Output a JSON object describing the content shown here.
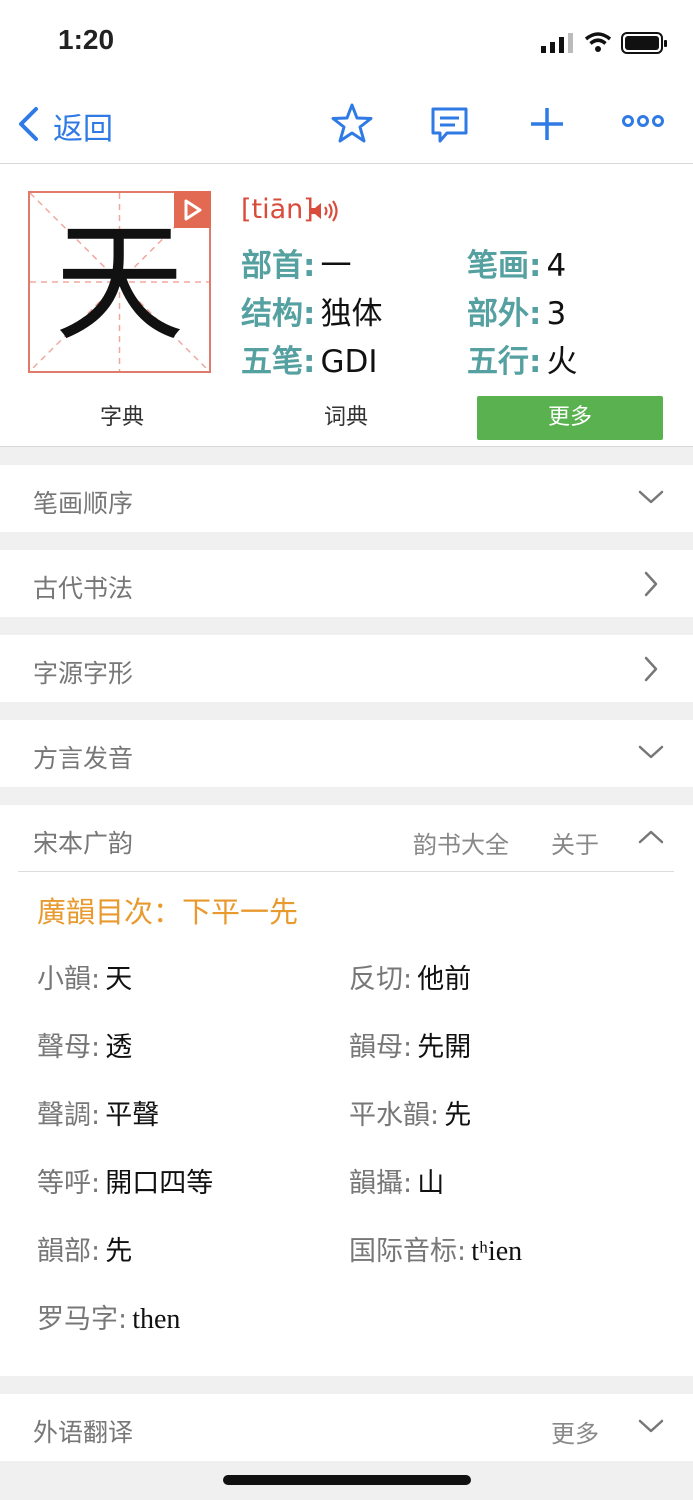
{
  "status": {
    "time": "1:20"
  },
  "nav": {
    "back_label": "返回"
  },
  "entry": {
    "character": "天",
    "pinyin": "[tiān]",
    "props": [
      {
        "label": "部首:",
        "value": "一"
      },
      {
        "label": "笔画:",
        "value": "4"
      },
      {
        "label": "结构:",
        "value": "独体"
      },
      {
        "label": "部外:",
        "value": "3"
      },
      {
        "label": "五笔:",
        "value": "GDI"
      },
      {
        "label": "五行:",
        "value": "火"
      }
    ]
  },
  "tabs": [
    {
      "label": "字典",
      "active": false
    },
    {
      "label": "词典",
      "active": false
    },
    {
      "label": "更多",
      "active": true
    }
  ],
  "sections": {
    "stroke_order": "笔画顺序",
    "calligraphy": "古代书法",
    "etymology": "字源字形",
    "dialect": "方言发音",
    "guangyun": "宋本广韵",
    "guangyun_link1": "韵书大全",
    "guangyun_link2": "关于",
    "translation": "外语翻译",
    "translation_more": "更多"
  },
  "guangyun": {
    "heading": "廣韻目次：下平一先",
    "rows": [
      {
        "label": "小韻:",
        "value": "天"
      },
      {
        "label": "反切:",
        "value": "他前"
      },
      {
        "label": "聲母:",
        "value": "透"
      },
      {
        "label": "韻母:",
        "value": "先開"
      },
      {
        "label": "聲調:",
        "value": "平聲"
      },
      {
        "label": "平水韻:",
        "value": "先"
      },
      {
        "label": "等呼:",
        "value": "開口四等"
      },
      {
        "label": "韻攝:",
        "value": "山"
      },
      {
        "label": "韻部:",
        "value": "先"
      },
      {
        "label": "国际音标:",
        "value": "tʰien"
      },
      {
        "label": "罗马字:",
        "value": "then"
      }
    ]
  },
  "colors": {
    "accent": "#2f7ae5",
    "active_tab": "#5ab150",
    "label_teal": "#55a0a0",
    "pinyin_red": "#d94c3b",
    "heading_orange": "#e89a2f"
  }
}
